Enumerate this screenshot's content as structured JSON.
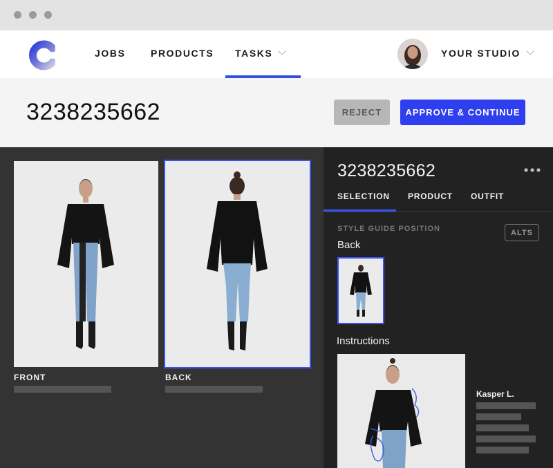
{
  "nav": {
    "items": [
      "JOBS",
      "PRODUCTS",
      "TASKS"
    ],
    "studio_label": "YOUR STUDIO"
  },
  "header": {
    "title": "3238235662",
    "reject_label": "REJECT",
    "approve_label": "APPROVE & CONTINUE"
  },
  "photos": {
    "front_label": "FRONT",
    "back_label": "BACK"
  },
  "panel": {
    "title": "3238235662",
    "tabs": [
      "SELECTION",
      "PRODUCT",
      "OUTFIT"
    ],
    "style_guide_label": "STYLE GUIDE POSITION",
    "alts_label": "ALTS",
    "style_guide_value": "Back",
    "instructions_title": "Instructions",
    "instructions_author": "Kasper L."
  },
  "colors": {
    "accent": "#2f3ff0",
    "reject": "#b7b7b7",
    "dark_panel": "#333333",
    "side_panel": "#222222"
  },
  "icons": {
    "logo": "brand-c-logo",
    "more": "more-horizontal-icon",
    "chevron": "chevron-down-icon"
  }
}
